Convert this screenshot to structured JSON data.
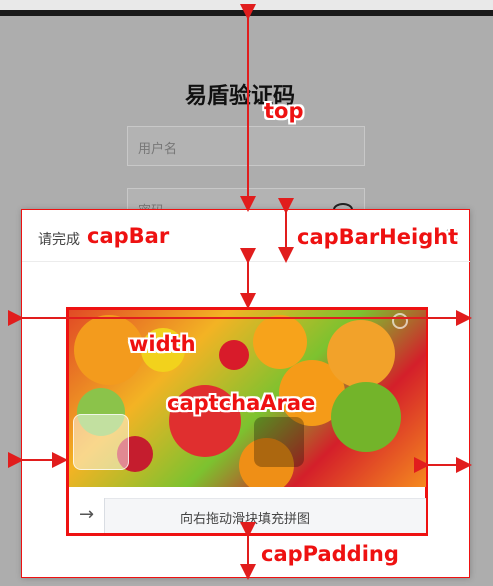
{
  "login": {
    "title": "易盾验证码",
    "username_placeholder": "用户名",
    "password_placeholder": "密码"
  },
  "captcha": {
    "title": "请完成",
    "slider_text": "向右拖动滑块填充拼图",
    "handle_icon": "arrow-right-icon"
  },
  "annotations": {
    "top": "top",
    "capBar": "capBar",
    "capBarHeight": "capBarHeight",
    "width": "width",
    "captchaArea": "captchaArae",
    "capPadding": "capPadding"
  },
  "colors": {
    "annotation": "#e11d1d",
    "overlay": "#adadad",
    "modal": "#ffffff"
  }
}
